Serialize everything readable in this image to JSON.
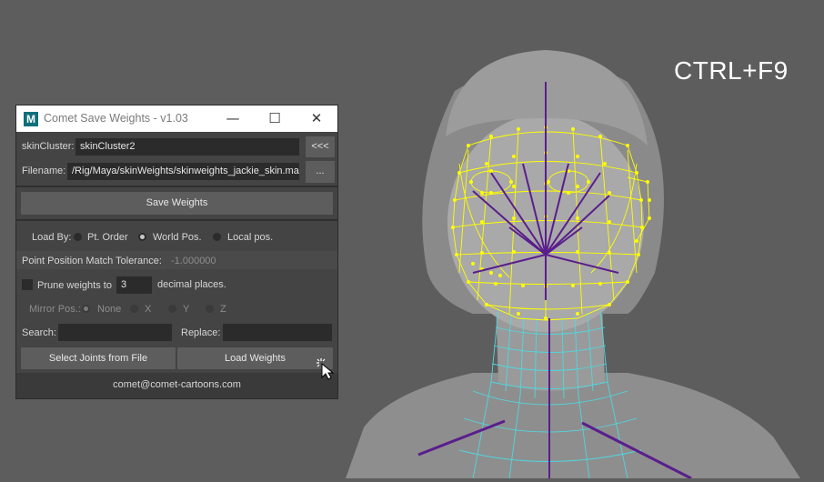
{
  "viewport": {
    "hotkey_label": "CTRL+F9"
  },
  "window": {
    "title": "Comet Save Weights - v1.03",
    "app_icon": "M",
    "controls": {
      "minimize": "—",
      "maximize": "☐",
      "close": "✕"
    }
  },
  "skincluster": {
    "label": "skinCluster:",
    "value": "skinCluster2",
    "pick_button": "<<<"
  },
  "filename": {
    "label": "Filename:",
    "value": "/Rig/Maya/skinWeights/skinweights_jackie_skin.ma",
    "browse_button": "..."
  },
  "save_button": "Save Weights",
  "load_by": {
    "label": "Load By:",
    "options": [
      "Pt. Order",
      "World Pos.",
      "Local pos."
    ],
    "selected": "World Pos."
  },
  "tolerance": {
    "label": "Point Position Match Tolerance:",
    "value": "-1.000000"
  },
  "prune": {
    "label": "Prune weights to",
    "value": "3",
    "suffix": "decimal places."
  },
  "mirror": {
    "label": "Mirror Pos.:",
    "options": [
      "None",
      "X",
      "Y",
      "Z"
    ],
    "selected": "None"
  },
  "search": {
    "label": "Search:",
    "value": ""
  },
  "replace": {
    "label": "Replace:",
    "value": ""
  },
  "select_joints_button": "Select Joints from File",
  "load_weights_button": "Load Weights",
  "footer": {
    "email": "comet@comet-cartoons.com"
  },
  "colors": {
    "viewport_bg": "#5d5d5d",
    "wireframe_yellow": "#ffff00",
    "wireframe_cyan": "#4fd8e0",
    "joint_purple": "#5a1e8c"
  }
}
